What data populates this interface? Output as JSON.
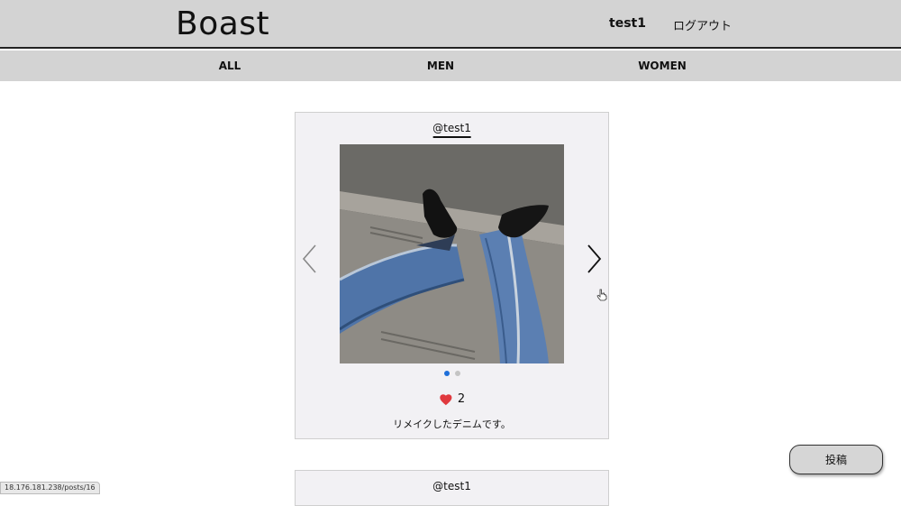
{
  "header": {
    "logo": "Boast",
    "user_name": "test1",
    "logout_label": "ログアウト"
  },
  "nav": {
    "items": [
      {
        "label": "ALL"
      },
      {
        "label": "MEN"
      },
      {
        "label": "WOMEN"
      }
    ]
  },
  "posts": [
    {
      "author": "@test1",
      "likes": "2",
      "caption": "リメイクしたデニムです。",
      "carousel": {
        "slide_count": 2,
        "active_index": 0
      }
    },
    {
      "author": "@test1"
    }
  ],
  "post_button_label": "投稿",
  "status_url": "18.176.181.238/posts/16",
  "colors": {
    "header_bg": "#d3d3d3",
    "card_bg": "#f2f1f4",
    "like_heart": "#e0393e",
    "dot_active": "#1e6fd9",
    "dot_inactive": "#c4c4c4"
  },
  "icons": {
    "prev": "chevron-left-icon",
    "next": "chevron-right-icon",
    "like": "heart-icon"
  }
}
